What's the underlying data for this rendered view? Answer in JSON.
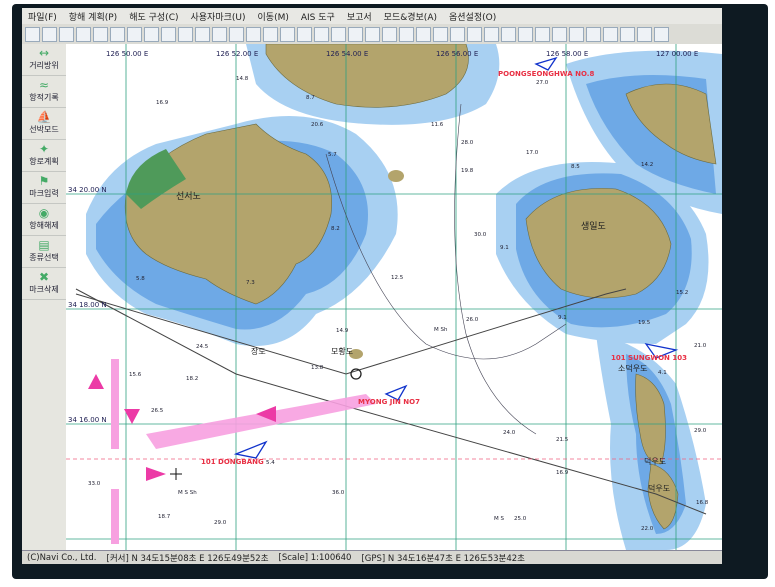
{
  "menu": [
    "파일(F)",
    "항해 계획(P)",
    "해도 구성(C)",
    "사용자마크(U)",
    "이동(M)",
    "AIS 도구",
    "보고서",
    "모드&경보(A)",
    "옵션설정(O)"
  ],
  "sidebar": [
    {
      "label": "거리방위",
      "icon": "↔"
    },
    {
      "label": "항적기록",
      "icon": "≈"
    },
    {
      "label": "선박모드",
      "icon": "⛵"
    },
    {
      "label": "항로계획",
      "icon": "✦"
    },
    {
      "label": "마크입력",
      "icon": "⚑"
    },
    {
      "label": "항해해제",
      "icon": "◉"
    },
    {
      "label": "종류선택",
      "icon": "▤"
    },
    {
      "label": "마크삭제",
      "icon": "✖"
    }
  ],
  "chart": {
    "lon_labels": [
      "126 50.00 E",
      "126 52.00 E",
      "126 54.00 E",
      "126 56.00 E",
      "126 58.00 E",
      "127 00.00 E"
    ],
    "lat_labels": [
      "34 20.00 N",
      "34 18.00 N",
      "34 16.00 N"
    ],
    "islands": [
      "선서노",
      "생일도",
      "장도",
      "모황도",
      "소덕우도",
      "덕우도",
      "덕우도"
    ],
    "vessels": [
      "POONGSEONGHWA NO.8",
      "MYONG JIN NO7",
      "101 DONGBANG",
      "101 SUNGWON 103"
    ],
    "depths": [
      "14.8",
      "16.9",
      "8.7",
      "20.6",
      "28.0",
      "11.6",
      "19.8",
      "17.0",
      "27.0",
      "14.2",
      "5.7",
      "9.1",
      "8.2",
      "30.0",
      "12.5",
      "8.5",
      "9.1",
      "4.1",
      "15.2",
      "19.5",
      "24.5",
      "13.8",
      "15.6",
      "26.0",
      "21.0",
      "24.0",
      "21.5",
      "16.9",
      "29.0",
      "36.0",
      "25.0",
      "22.0",
      "16.8",
      "29.0",
      "18.7",
      "33.0",
      "5.8",
      "7.3",
      "14.9",
      "18.2",
      "26.5",
      "5.4"
    ],
    "msh": [
      "M Sh",
      "M S Sh",
      "M S"
    ]
  },
  "status": {
    "company": "(C)Navi Co., Ltd.",
    "cursor": "[커서] N 34도15분08초 E 126도49분52초",
    "scale": "[Scale] 1:100640",
    "gps": "[GPS] N 34도16분47초 E 126도53분42초"
  },
  "colors": {
    "land": "#b3a46c",
    "shallow": "#6ea9e6",
    "mid": "#a8d0f2",
    "deep": "#ffffff",
    "grid": "#2fa080",
    "vessel": "#e83044",
    "route": "#f7a0e0"
  }
}
